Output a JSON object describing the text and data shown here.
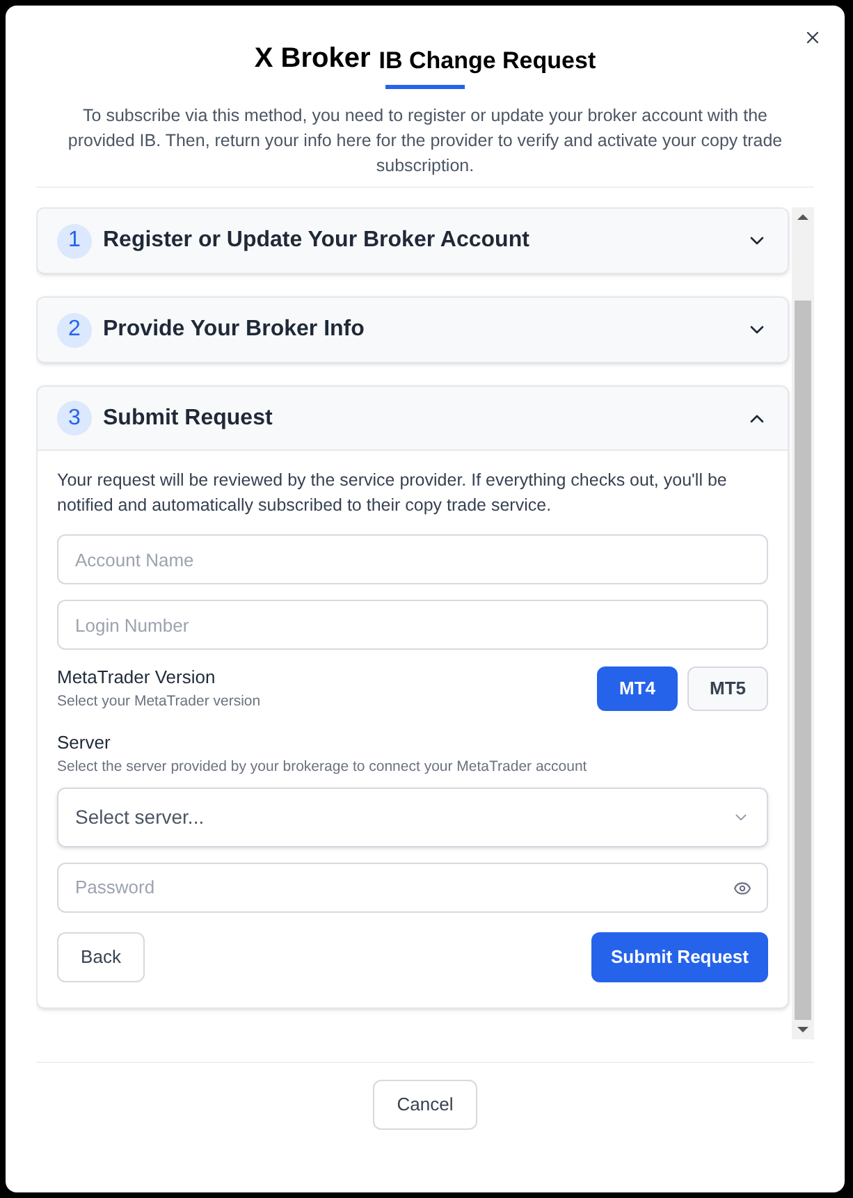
{
  "dialog": {
    "brand": "X Broker",
    "title": "IB Change Request",
    "intro": "To subscribe via this method, you need to register or update your broker account with the provided IB. Then, return your info here for the provider to verify and activate your copy trade subscription."
  },
  "steps": [
    {
      "number": "1",
      "title": "Register or Update Your Broker Account",
      "expanded": false
    },
    {
      "number": "2",
      "title": "Provide Your Broker Info",
      "expanded": false
    },
    {
      "number": "3",
      "title": "Submit Request",
      "expanded": true
    }
  ],
  "form": {
    "description": "Your request will be reviewed by the service provider. If everything checks out, you'll be notified and automatically subscribed to their copy trade service.",
    "account_name": {
      "placeholder": "Account Name"
    },
    "login_number": {
      "placeholder": "Login Number"
    },
    "version": {
      "label": "MetaTrader Version",
      "hint": "Select your MetaTrader version",
      "options": [
        {
          "label": "MT4",
          "selected": true
        },
        {
          "label": "MT5",
          "selected": false
        }
      ]
    },
    "server": {
      "label": "Server",
      "hint": "Select the server provided by your brokerage to connect your MetaTrader account",
      "placeholder": "Select server..."
    },
    "password": {
      "placeholder": "Password"
    },
    "back": "Back",
    "submit": "Submit Request"
  },
  "cancel": "Cancel"
}
